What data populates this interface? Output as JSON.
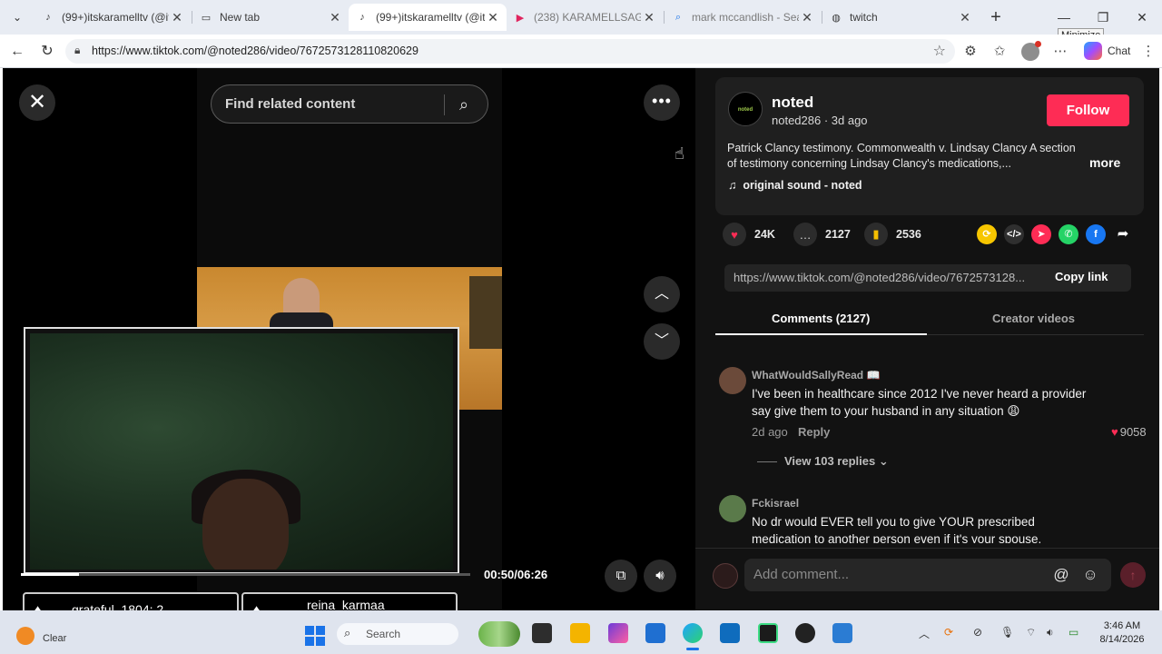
{
  "browser": {
    "tabs": [
      {
        "title": "(99+)itskaramelltv (@its",
        "favicon": "tiktok-icon",
        "active": false
      },
      {
        "title": "New tab",
        "favicon": "newtab-icon",
        "active": false
      },
      {
        "title": "(99+)itskaramelltv (@its",
        "favicon": "tiktok-icon",
        "active": true
      },
      {
        "title": "(238) KARAMELLSAGIC",
        "favicon": "youtube-icon",
        "active": false
      },
      {
        "title": "mark mccandlish - Sear",
        "favicon": "search-icon",
        "active": false
      },
      {
        "title": "twitch",
        "favicon": "globe-icon",
        "active": false
      }
    ],
    "url": "https://www.tiktok.com/@noted286/video/7672573128110820629",
    "tooltip": "Minimize",
    "chat_label": "Chat"
  },
  "player": {
    "search_placeholder": "Find related content",
    "time": "00:50/06:26",
    "progress": 0.13,
    "gifts": [
      {
        "name": "grateful_1804: 2"
      },
      {
        "name": "reina_karmaa"
      }
    ]
  },
  "author": {
    "name": "noted",
    "handle_line": "noted286 · 3d ago",
    "follow_label": "Follow",
    "avatar_text": "noted",
    "description": "Patrick Clancy testimony. Commonwealth v. Lindsay Clancy A section of testimony concerning Lindsay Clancy's medications,...",
    "more_label": "more",
    "music": "original sound - noted"
  },
  "stats": {
    "likes": "24K",
    "comments": "2127",
    "saves": "2536"
  },
  "share": {
    "link": "https://www.tiktok.com/@noted286/video/7672573128...",
    "copy_label": "Copy link"
  },
  "panel_tabs": {
    "comments": "Comments (2127)",
    "creator": "Creator videos"
  },
  "comments": [
    {
      "user": "WhatWouldSallyRead 📖",
      "text": "I've been in healthcare since 2012 I've never heard a provider say give them to your husband in any situation 😩",
      "age": "2d ago",
      "reply_label": "Reply",
      "likes": "9058",
      "view_replies": "View 103 replies ⌄"
    },
    {
      "user": "Fckisrael",
      "text": "No dr would EVER tell you to give YOUR prescribed medication to another person even if it's your spouse."
    }
  ],
  "comment_bar": {
    "placeholder": "Add comment..."
  },
  "taskbar": {
    "weather_label": "Clear",
    "search_placeholder": "Search",
    "time": "3:46 AM",
    "date": "8/14/2026"
  }
}
